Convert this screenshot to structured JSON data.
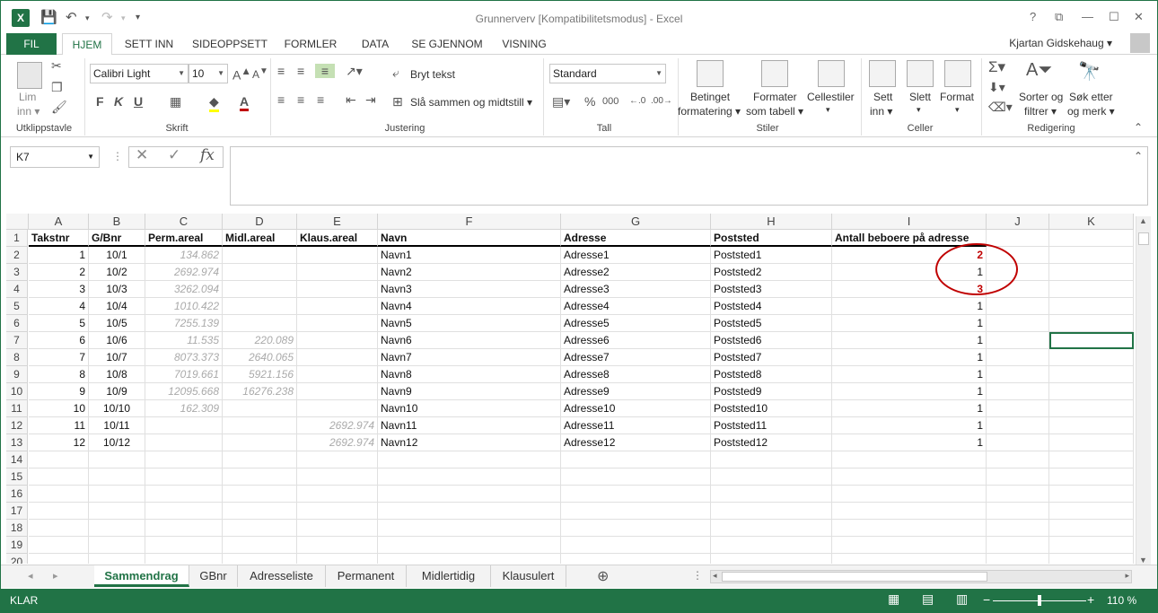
{
  "window": {
    "title": "Grunnerverv  [Kompatibilitetsmodus] - Excel",
    "app_icon": "excel-icon",
    "controls": [
      "?",
      "⧉",
      "—",
      "☐",
      "✕"
    ]
  },
  "quick_access": {
    "save": "save-icon",
    "undo": "undo-icon",
    "redo": "redo-icon",
    "customize": "▾"
  },
  "ribbon_tabs": [
    "FIL",
    "HJEM",
    "SETT INN",
    "SIDEOPPSETT",
    "FORMLER",
    "DATA",
    "SE GJENNOM",
    "VISNING"
  ],
  "active_tab": "HJEM",
  "user": {
    "name": "Kjartan Gidskehaug"
  },
  "ribbon": {
    "clipboard": {
      "paste_label": "Lim\ninn",
      "paste_top": "Lim",
      "paste_bottom": "inn ▾",
      "group": "Utklippstavle"
    },
    "font": {
      "family": "Calibri Light",
      "size": "10",
      "bold": "F",
      "italic": "K",
      "underline": "U",
      "group": "Skrift"
    },
    "alignment": {
      "wrap": "Bryt tekst",
      "merge": "Slå sammen og midtstill",
      "group": "Justering"
    },
    "number": {
      "format": "Standard",
      "percent": "%",
      "thousands": "000",
      "group": "Tall"
    },
    "styles": {
      "conditional_1": "Betinget",
      "conditional_2": "formatering ▾",
      "table_1": "Formater",
      "table_2": "som tabell ▾",
      "cell_1": "Cellestiler",
      "cell_2": "▾",
      "group": "Stiler"
    },
    "cells": {
      "insert_1": "Sett",
      "insert_2": "inn ▾",
      "delete_1": "Slett",
      "delete_2": "▾",
      "format_1": "Format",
      "format_2": "▾",
      "group": "Celler"
    },
    "editing": {
      "sort_1": "Sorter og",
      "sort_2": "filtrer ▾",
      "find_1": "Søk etter",
      "find_2": "og merk ▾",
      "group": "Redigering"
    }
  },
  "formula_bar": {
    "name_box": "K7",
    "fx": "fx",
    "value": ""
  },
  "columns": [
    "A",
    "B",
    "C",
    "D",
    "E",
    "F",
    "G",
    "H",
    "I",
    "J",
    "K"
  ],
  "table": {
    "headers": [
      "Takstnr",
      "G/Bnr",
      "Perm.areal",
      "Midl.areal",
      "Klaus.areal",
      "Navn",
      "Adresse",
      "Poststed",
      "Antall beboere på adresse"
    ],
    "rows": [
      [
        "1",
        "10/1",
        "134.862",
        "",
        "",
        "Navn1",
        "Adresse1",
        "Poststed1",
        "2"
      ],
      [
        "2",
        "10/2",
        "2692.974",
        "",
        "",
        "Navn2",
        "Adresse2",
        "Poststed2",
        "1"
      ],
      [
        "3",
        "10/3",
        "3262.094",
        "",
        "",
        "Navn3",
        "Adresse3",
        "Poststed3",
        "3"
      ],
      [
        "4",
        "10/4",
        "1010.422",
        "",
        "",
        "Navn4",
        "Adresse4",
        "Poststed4",
        "1"
      ],
      [
        "5",
        "10/5",
        "7255.139",
        "",
        "",
        "Navn5",
        "Adresse5",
        "Poststed5",
        "1"
      ],
      [
        "6",
        "10/6",
        "11.535",
        "220.089",
        "",
        "Navn6",
        "Adresse6",
        "Poststed6",
        "1"
      ],
      [
        "7",
        "10/7",
        "8073.373",
        "2640.065",
        "",
        "Navn7",
        "Adresse7",
        "Poststed7",
        "1"
      ],
      [
        "8",
        "10/8",
        "7019.661",
        "5921.156",
        "",
        "Navn8",
        "Adresse8",
        "Poststed8",
        "1"
      ],
      [
        "9",
        "10/9",
        "12095.668",
        "16276.238",
        "",
        "Navn9",
        "Adresse9",
        "Poststed9",
        "1"
      ],
      [
        "10",
        "10/10",
        "162.309",
        "",
        "",
        "Navn10",
        "Adresse10",
        "Poststed10",
        "1"
      ],
      [
        "11",
        "10/11",
        "",
        "",
        "2692.974",
        "Navn11",
        "Adresse11",
        "Poststed11",
        "1"
      ],
      [
        "12",
        "10/12",
        "",
        "",
        "2692.974",
        "Navn12",
        "Adresse12",
        "Poststed12",
        "1"
      ]
    ],
    "row_numbers": [
      "1",
      "2",
      "3",
      "4",
      "5",
      "6",
      "7",
      "8",
      "9",
      "10",
      "11",
      "12",
      "13",
      "14",
      "15",
      "16",
      "17",
      "18",
      "19",
      "20"
    ],
    "highlight_color": "#c00000"
  },
  "sheet_tabs": [
    "Sammendrag",
    "GBnr",
    "Adresseliste",
    "Permanent",
    "Midlertidig",
    "Klausulert"
  ],
  "active_sheet": "Sammendrag",
  "status": {
    "mode": "KLAR",
    "zoom": "110 %"
  },
  "colors": {
    "accent": "#217346",
    "annotation": "#c00000"
  }
}
